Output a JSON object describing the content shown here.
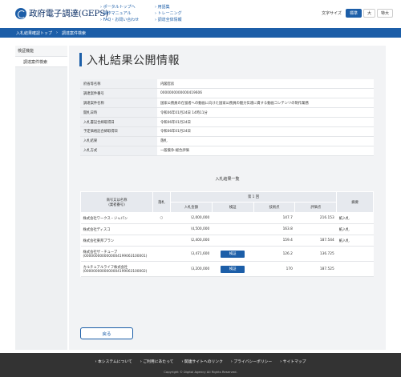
{
  "header": {
    "logo_text": "政府電子調達(GEPS)",
    "links_col1": [
      "ポータルトップへ",
      "操作マニュアル",
      "FAQ・お問い合わせ"
    ],
    "links_col2": [
      "用語集",
      "トレーニング",
      "調達全体情報"
    ],
    "font_size_label": "文字サイズ",
    "font_sizes": [
      "標準",
      "大",
      "特大"
    ]
  },
  "breadcrumb": [
    "入札結果確認トップ",
    "調達案件検索"
  ],
  "sidebar": {
    "heading": "検証機能",
    "item": "調達案件検索"
  },
  "main": {
    "title": "入札結果公開情報",
    "info_rows": [
      {
        "key": "府省等名称",
        "value": "内閣官房"
      },
      {
        "key": "調達案件番号",
        "value": "0000000000000419606"
      },
      {
        "key": "調達案件名称",
        "value": "国家公務員の在留者への動画に向けた国家公務員の魅力伝達に資する動画コンテンツの制作業務"
      },
      {
        "key": "開札日時",
        "value": "令和06年01月24日 14時11分"
      },
      {
        "key": "入札書記合締取得日",
        "value": "令和06年01月24日"
      },
      {
        "key": "予定価格記合締取得日",
        "value": "令和06年01月24日"
      },
      {
        "key": "入札結果",
        "value": "落札"
      },
      {
        "key": "入札方式",
        "value": "一般競争-総合評価"
      }
    ],
    "results_title": "入札結果一覧",
    "results_header": {
      "name": "商号又は名称",
      "name_sub": "(業者番号)",
      "winner": "落札",
      "round": "第 1 回",
      "amount": "入札金額",
      "verify": "検証",
      "tech_score": "技術点",
      "eval_score": "評価点",
      "remarks": "摘要"
    },
    "results": [
      {
        "name": "株式会社ワークス・ジャパン",
        "code": "",
        "winner": "○",
        "amount": "\\2,000,000",
        "verify": "",
        "tech": "147.7",
        "eval": "216.153",
        "remark": "紙入札"
      },
      {
        "name": "株式会社ディスコ",
        "code": "",
        "winner": "",
        "amount": "\\4,500,000",
        "verify": "",
        "tech": "163.8",
        "eval": "",
        "remark": "紙入札"
      },
      {
        "name": "株式会社東邦プラン",
        "code": "",
        "winner": "",
        "amount": "\\2,400,000",
        "verify": "",
        "tech": "159.4",
        "eval": "187.544",
        "remark": "紙入札"
      },
      {
        "name": "株式会社ザ・チューブ",
        "code": "(0000000000000004199063100001)",
        "winner": "",
        "amount": "\\3,471,600",
        "verify": "検証",
        "tech": "126.2",
        "eval": "136.725",
        "remark": ""
      },
      {
        "name": "カルチュアルライフ株式会社",
        "code": "(0000000000000004199063100002)",
        "winner": "",
        "amount": "\\3,200,000",
        "verify": "検証",
        "tech": "170",
        "eval": "187.525",
        "remark": ""
      }
    ],
    "back_label": "戻る"
  },
  "footer": {
    "links": [
      "本システムについて",
      "ご利用にあたって",
      "関連サイトへのリンク",
      "プライバシーポリシー",
      "サイトマップ"
    ],
    "copyright": "Copyright © Digital Agency All Rights Reserved."
  },
  "colors": {
    "accent": "#1c5ea8",
    "footer": "#333333"
  }
}
